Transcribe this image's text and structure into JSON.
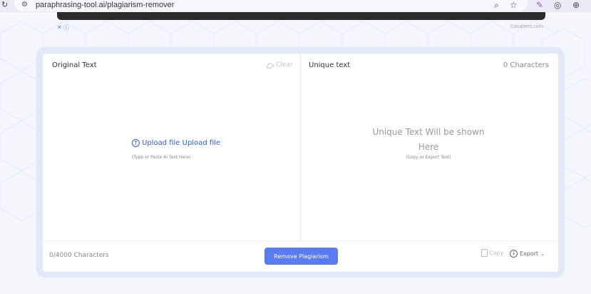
{
  "browser": {
    "url": "paraphrasing-tool.ai/plagiarism-remover",
    "reload_icon": "reload-icon",
    "site_info_icon": "site-info-icon",
    "zoom_icon": "zoom-icon",
    "star_icon": "bookmark-star-icon"
  },
  "ad": {
    "close_mark": "✕ ⓘ",
    "source": "Casahero.com"
  },
  "left_panel": {
    "title": "Original Text",
    "clear_label": "Clear",
    "upload_label": "Upload file Upload file",
    "hint": "(Type or Paste AI Text Here)",
    "counter": "0/4000 Characters"
  },
  "right_panel": {
    "title": "Unique text",
    "char_count": "0 Characters",
    "placeholder": "Unique Text Will be shown Here",
    "hint": "(Copy or Export Text)",
    "copy_label": "Copy",
    "export_label": "Export"
  },
  "actions": {
    "remove_label": "Remove Plagiarism"
  },
  "colors": {
    "accent": "#5b7cf0",
    "link": "#2f5fd8",
    "card_frame": "#e3e7fa"
  }
}
